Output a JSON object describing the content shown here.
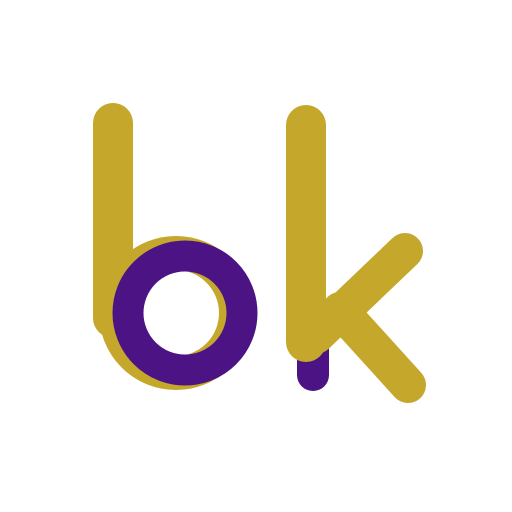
{
  "logo": {
    "text": "bk",
    "icon": "bk-monogram-icon"
  },
  "colors": {
    "background": "#ffffff",
    "gold": "#c5a72b",
    "purple": "#4c1385"
  }
}
